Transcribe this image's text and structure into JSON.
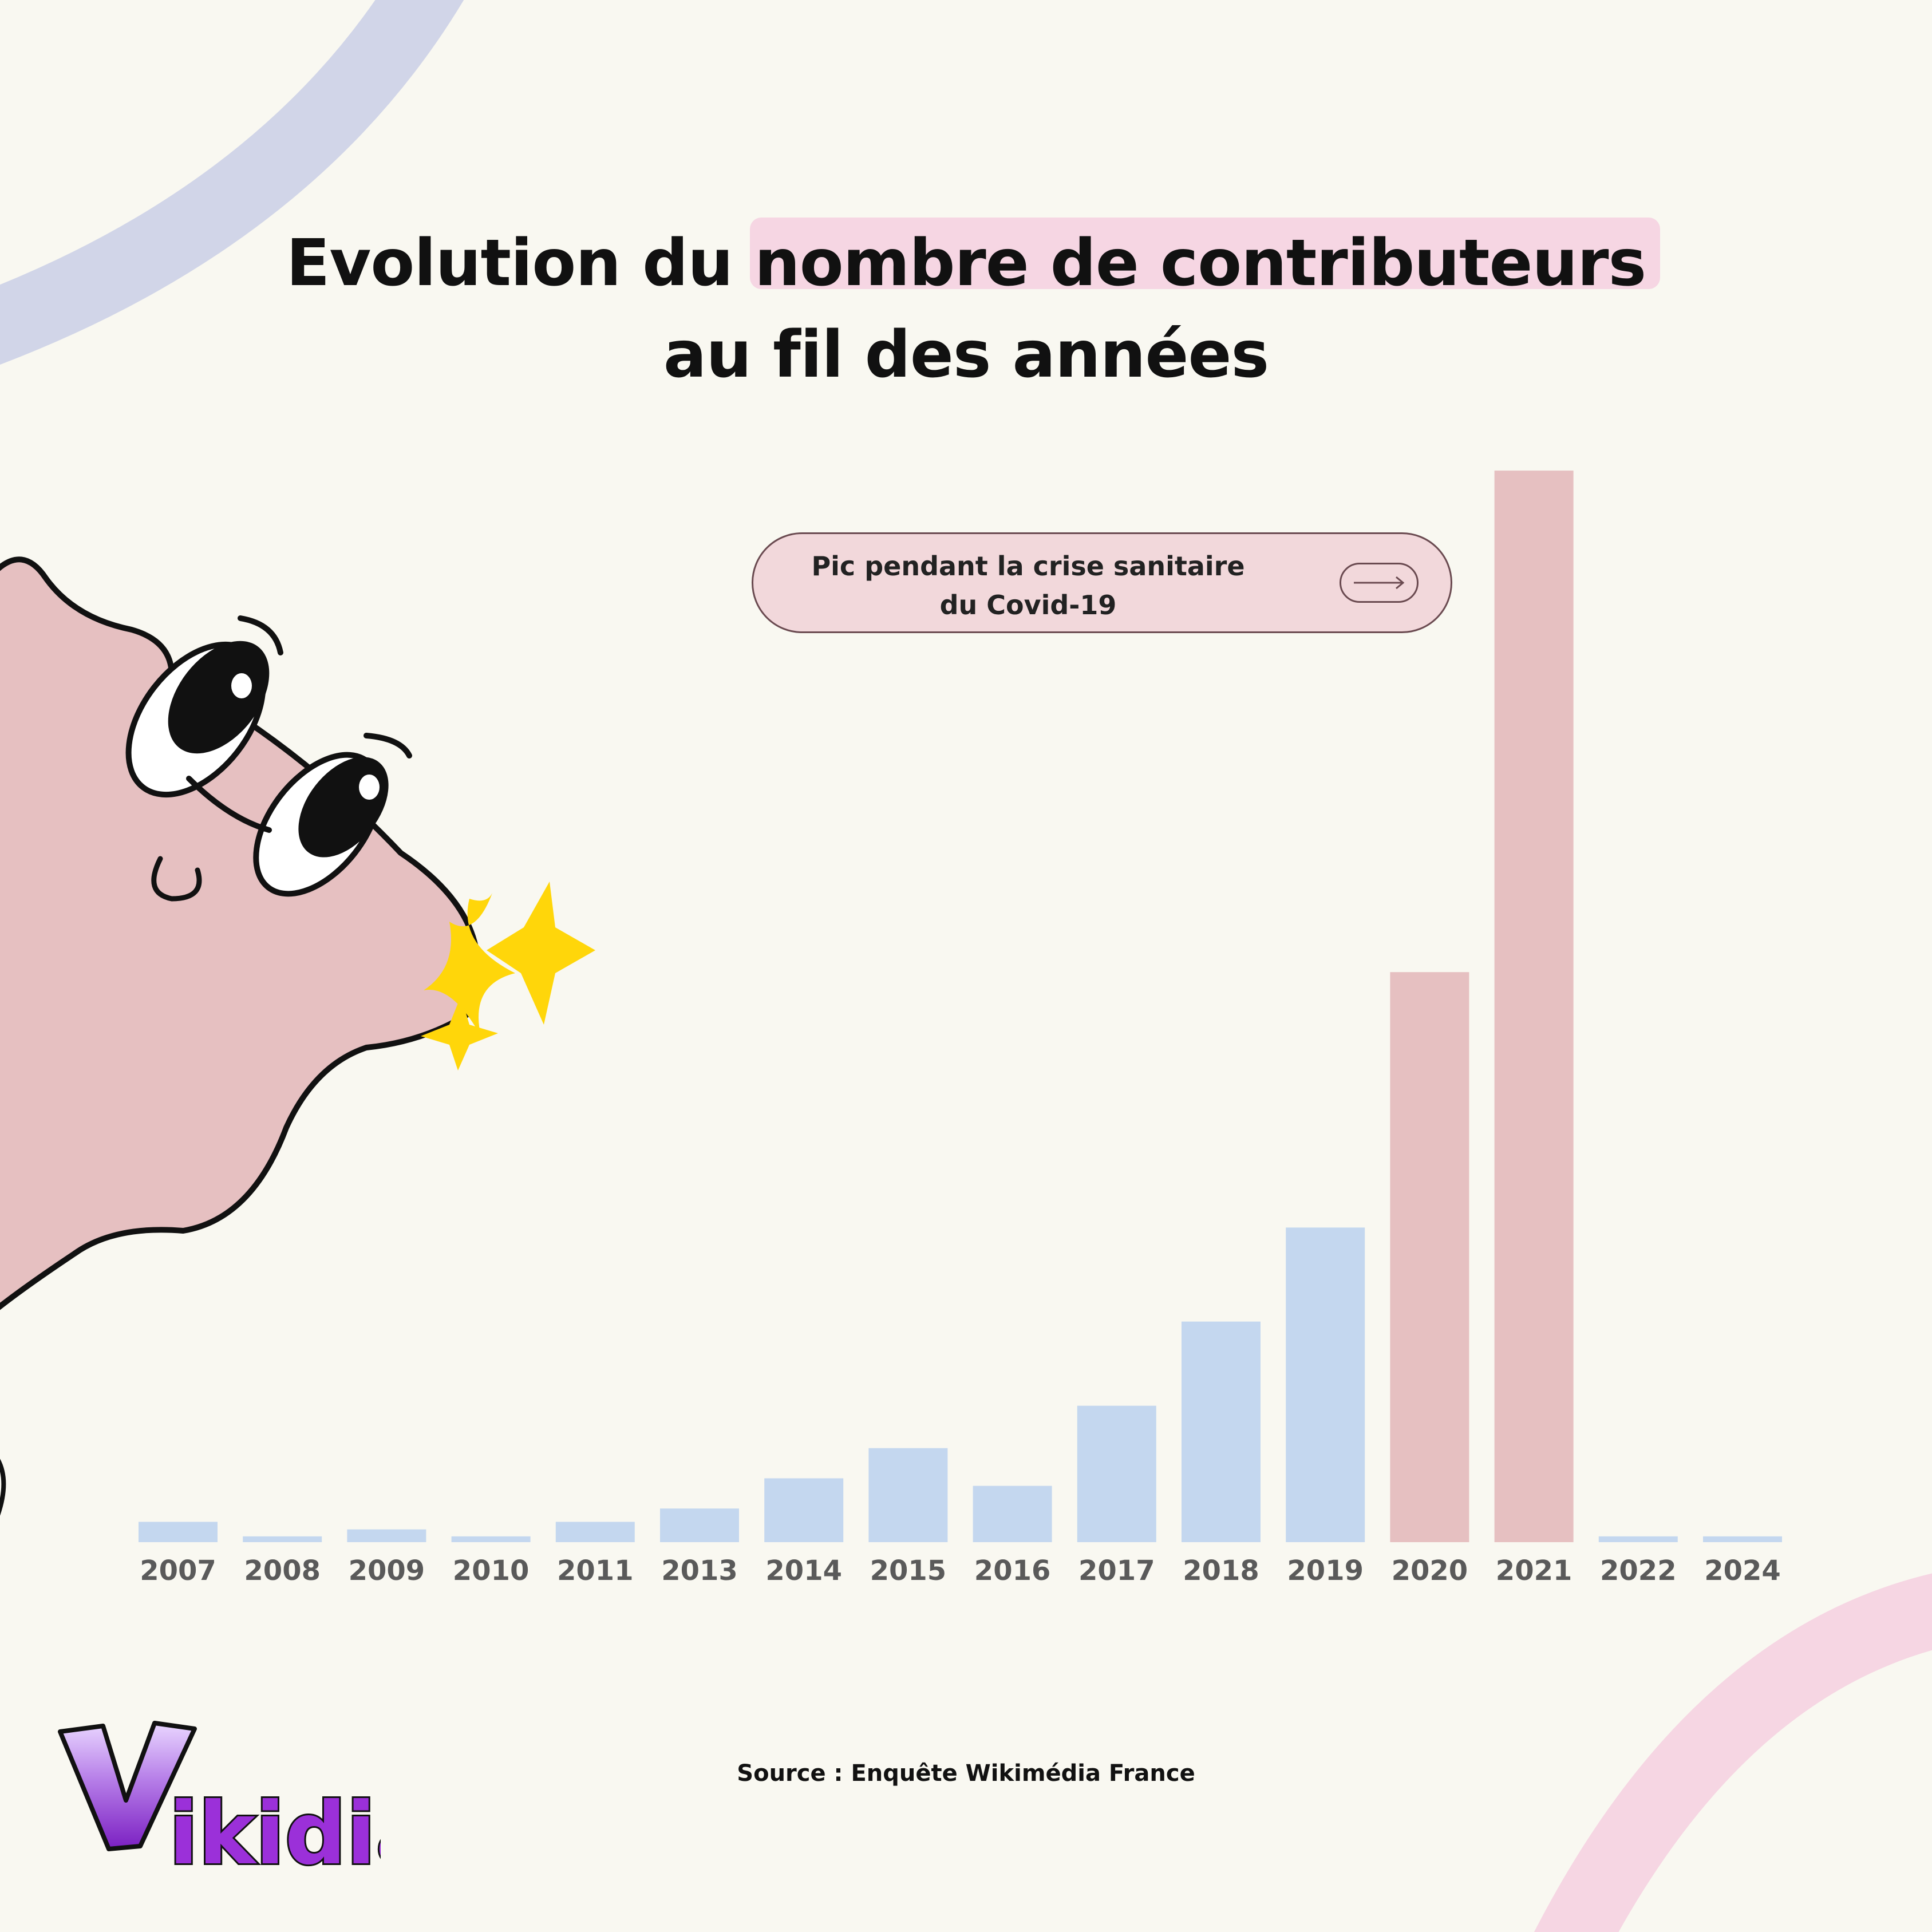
{
  "title": {
    "line1_part1": "Evolution du ",
    "line1_highlight": "nombre de contributeurs",
    "line2": "au fil des années"
  },
  "callout": {
    "text": "Pic pendant la crise sanitaire du Covid-19",
    "icon": "arrow-right-icon"
  },
  "source": "Source : Enquête Wikimédia France",
  "logo_text": "Vikidia",
  "colors": {
    "background": "#f9f8f1",
    "bar_default": "#c4d7ef",
    "bar_highlight": "#e6c0c1",
    "title_highlight": "#f6d6e3",
    "deco_lavender": "#d1d5e8",
    "deco_pink": "#f6d6e3",
    "mascot": "#e6c0c1",
    "sparkle": "#ffd60a",
    "logo_purple": "#8a2be2"
  },
  "chart_data": {
    "type": "bar",
    "title": "",
    "xlabel": "",
    "ylabel": "",
    "categories": [
      "2007",
      "2008",
      "2009",
      "2010",
      "2011",
      "2013",
      "2014",
      "2015",
      "2016",
      "2017",
      "2018",
      "2019",
      "2020",
      "2021",
      "2022",
      "2024"
    ],
    "values": [
      35,
      10,
      22,
      10,
      35,
      58,
      110,
      162,
      97,
      235,
      380,
      542,
      982,
      1846,
      10,
      10
    ],
    "highlighted": [
      "2020",
      "2021"
    ],
    "ylim": [
      0,
      1850
    ],
    "grid": false,
    "legend": "none"
  }
}
